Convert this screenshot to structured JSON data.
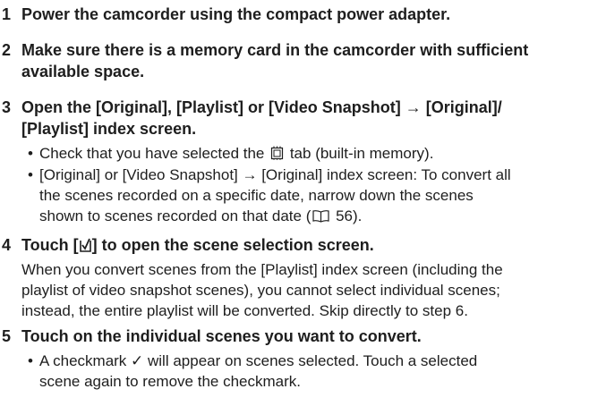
{
  "steps": [
    {
      "number": "1",
      "title": [
        "Power the camcorder using the compact power adapter."
      ]
    },
    {
      "number": "2",
      "title": [
        "Make sure there is a memory card in the camcorder with sufficient",
        "available space."
      ]
    },
    {
      "number": "3",
      "title": [
        "Open the [Original], [Playlist] or [Video Snapshot] → [Original]/",
        "[Playlist] index screen."
      ],
      "bullets": [
        {
          "before_icon": "Check that you have selected the ",
          "icon": "built-in-memory-icon",
          "after_icon": " tab (built-in memory)."
        },
        {
          "lines": [
            "[Original] or [Video Snapshot] → [Original] index screen: To convert all",
            "the scenes recorded on a specific date, narrow down the scenes"
          ],
          "line3_before_icon": "shown to scenes recorded on that date (",
          "line3_icon": "book-reference-icon",
          "line3_after_icon": " 56)."
        }
      ]
    },
    {
      "number": "4",
      "title_before_icon": "Touch [",
      "title_icon": "select-checkbox-icon",
      "title_after_icon": "] to open the scene selection screen.",
      "para": [
        "When you convert scenes from the [Playlist] index screen (including the",
        "playlist of video snapshot scenes), you cannot select individual scenes;",
        "instead, the entire playlist will be converted. Skip directly to step 6."
      ]
    },
    {
      "number": "5",
      "title": [
        "Touch on the individual scenes you want to convert."
      ],
      "bullets": [
        {
          "lines": [
            "A checkmark ✓ will appear on scenes selected. Touch a selected",
            "scene again to remove the checkmark."
          ]
        }
      ]
    }
  ]
}
